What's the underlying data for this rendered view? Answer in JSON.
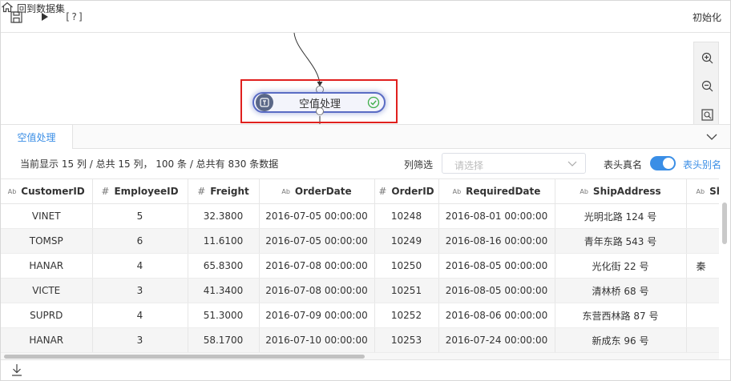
{
  "toolbar": {
    "help_label": "[?]",
    "back_label": "回到数据集",
    "init_label": "初始化"
  },
  "canvas": {
    "node": {
      "label": "空值处理",
      "status": "success"
    }
  },
  "panel": {
    "tab_label": "空值处理",
    "summary": "当前显示 15 列 / 总共 15 列， 100 条 / 总共有 830 条数据",
    "filter_label": "列筛选",
    "filter_placeholder": "请选择",
    "real_header_label": "表头真名",
    "header_alias_label": "表头别名",
    "header_switch_on": true
  },
  "table": {
    "columns": [
      {
        "type": "Ab",
        "name": "CustomerID"
      },
      {
        "type": "#",
        "name": "EmployeeID"
      },
      {
        "type": "#",
        "name": "Freight"
      },
      {
        "type": "Ab",
        "name": "OrderDate"
      },
      {
        "type": "#",
        "name": "OrderID"
      },
      {
        "type": "Ab",
        "name": "RequiredDate"
      },
      {
        "type": "Ab",
        "name": "ShipAddress"
      },
      {
        "type": "Ab",
        "name": "Sh"
      }
    ],
    "rows": [
      [
        "VINET",
        "5",
        "32.3800",
        "2016-07-05 00:00:00",
        "10248",
        "2016-08-01 00:00:00",
        "光明北路 124 号",
        ""
      ],
      [
        "TOMSP",
        "6",
        "11.6100",
        "2016-07-05 00:00:00",
        "10249",
        "2016-08-16 00:00:00",
        "青年东路 543 号",
        ""
      ],
      [
        "HANAR",
        "4",
        "65.8300",
        "2016-07-08 00:00:00",
        "10250",
        "2016-08-05 00:00:00",
        "光化街 22 号",
        "秦"
      ],
      [
        "VICTE",
        "3",
        "41.3400",
        "2016-07-08 00:00:00",
        "10251",
        "2016-08-05 00:00:00",
        "清林桥 68 号",
        ""
      ],
      [
        "SUPRD",
        "4",
        "51.3000",
        "2016-07-09 00:00:00",
        "10252",
        "2016-08-06 00:00:00",
        "东营西林路 87 号",
        ""
      ],
      [
        "HANAR",
        "3",
        "58.1700",
        "2016-07-10 00:00:00",
        "10253",
        "2016-07-24 00:00:00",
        "新成东 96 号",
        ""
      ],
      [
        "",
        "",
        "",
        "",
        "",
        "",
        "",
        ""
      ]
    ]
  },
  "colors": {
    "accent": "#3a8ee6",
    "highlight": "#e0201e",
    "node_border": "#5a6cc4",
    "ok_green": "#3fae49"
  }
}
